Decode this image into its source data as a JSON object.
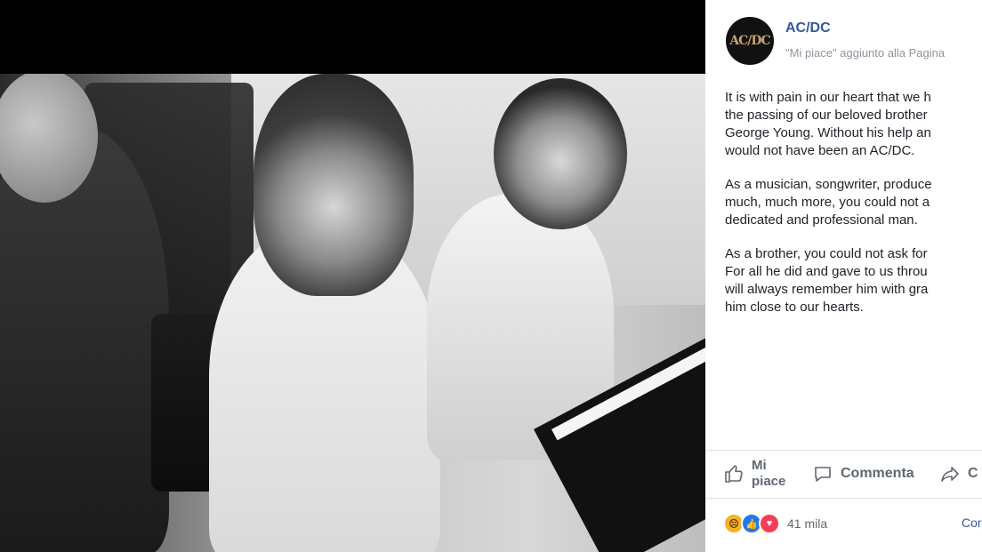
{
  "post": {
    "page_name": "AC/DC",
    "subline": "\"Mi piace\" aggiunto alla Pagina",
    "avatar_text": "AC/DC",
    "paragraphs": [
      "It is with pain in our heart that we h\nthe passing of our beloved brother\nGeorge Young. Without his help an\nwould not have been an AC/DC.",
      "As a musician, songwriter, produce\nmuch, much more, you could not a\ndedicated and professional man.",
      "As a brother, you could not ask for\nFor all he did and gave to us throu\nwill always remember him with gra\nhim close to our hearts."
    ]
  },
  "actions": {
    "like": "Mi\npiace",
    "comment": "Commenta",
    "share": "C"
  },
  "reactions": {
    "count": "41 mila",
    "comment_link": "Cor"
  },
  "colors": {
    "link": "#365899",
    "meta": "#90949c",
    "text": "#1d2129"
  },
  "icons": [
    "like-icon",
    "comment-icon",
    "share-icon",
    "sad-reaction-icon",
    "like-reaction-icon",
    "love-reaction-icon"
  ]
}
